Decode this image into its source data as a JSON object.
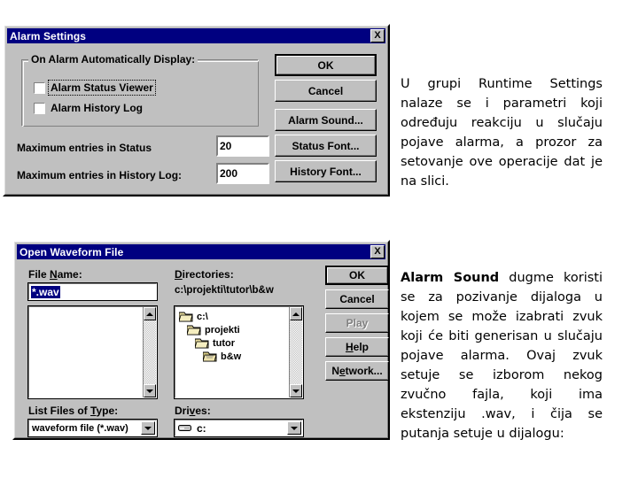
{
  "alarm_dialog": {
    "title": "Alarm Settings",
    "close_label": "X",
    "group_title": "On Alarm Automatically Display:",
    "checkboxes": [
      {
        "label": "Alarm Status Viewer",
        "checked": false,
        "focused": true
      },
      {
        "label": "Alarm History Log",
        "checked": false,
        "focused": false
      }
    ],
    "fields": [
      {
        "label": "Maximum entries in Status",
        "value": "20"
      },
      {
        "label": "Maximum entries in History Log:",
        "value": "200"
      }
    ],
    "buttons": [
      {
        "label": "OK",
        "default": true,
        "disabled": false
      },
      {
        "label": "Cancel",
        "default": false,
        "disabled": false
      },
      {
        "label": "Alarm Sound...",
        "default": false,
        "disabled": false
      },
      {
        "label": "Status Font...",
        "default": false,
        "disabled": false
      },
      {
        "label": "History Font...",
        "default": false,
        "disabled": false
      }
    ]
  },
  "open_dialog": {
    "title": "Open Waveform File",
    "close_label": "X",
    "file_name_label": "File Name:",
    "file_name_value": "*.wav",
    "file_list_items": [],
    "list_files_label": "List Files of Type:",
    "list_files_value": "waveform file (*.wav)",
    "directories_label": "Directories:",
    "current_path": "c:\\projekti\\tutor\\b&w",
    "tree": [
      {
        "label": "c:\\",
        "indent": 0,
        "open": true
      },
      {
        "label": "projekti",
        "indent": 1,
        "open": true
      },
      {
        "label": "tutor",
        "indent": 2,
        "open": true
      },
      {
        "label": "b&w",
        "indent": 3,
        "open": true
      }
    ],
    "drives_label": "Drives:",
    "drives_value": "c:",
    "buttons": [
      {
        "label": "OK",
        "default": true,
        "disabled": false
      },
      {
        "label": "Cancel",
        "default": false,
        "disabled": false
      },
      {
        "label": "Play",
        "default": false,
        "disabled": true
      },
      {
        "label": "Help",
        "default": false,
        "disabled": false
      },
      {
        "label": "Network...",
        "default": false,
        "disabled": false
      }
    ]
  },
  "prose": {
    "paragraph_1": "U grupi Runtime Settings nalaze se i parametri koji određuju reakciju u slučaju pojave alarma, a prozor za setovanje ove operacije dat je na slici.",
    "paragraph_2_bold": "Alarm Sound",
    "paragraph_2_rest": " dugme koristi se za pozivanje dijaloga u kojem se može izabrati zvuk koji će biti generisan u slučaju pojave alarma. Ovaj zvuk setuje se izborom nekog zvučno fajla, koji ima ekstenziju .wav, i čija se putanja setuje u dijalogu:"
  },
  "colors": {
    "face": "#c0c0c0",
    "title_active": "#000080",
    "highlight": "#000080",
    "folder": "#e8dc9c"
  }
}
